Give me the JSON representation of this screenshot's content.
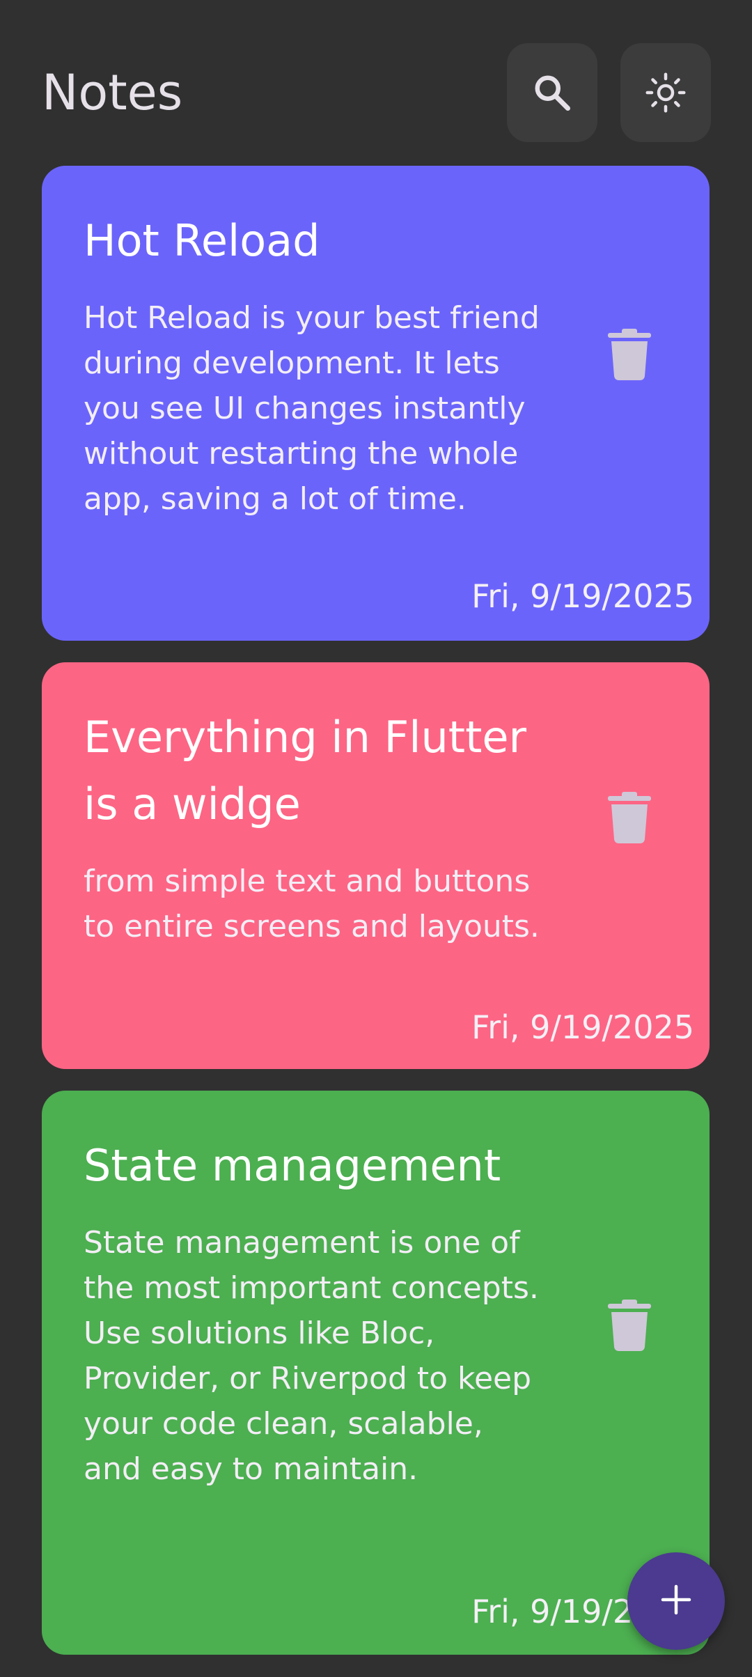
{
  "app": {
    "title": "Notes"
  },
  "header": {
    "search_icon": "search-icon",
    "theme_icon": "sun-icon"
  },
  "notes": [
    {
      "title": "Hot Reload",
      "body": "Hot Reload is your best friend during development. It lets you see UI changes instantly without restarting the whole app, saving a lot of time.",
      "date": "Fri, 9/19/2025",
      "color": "#6b64fb"
    },
    {
      "title": "Everything in Flutter is a widge",
      "body": "from simple text and buttons to entire screens and layouts.",
      "date": "Fri, 9/19/2025",
      "color": "#fd6585"
    },
    {
      "title": "State management",
      "body": "State management is one of the most important concepts. Use solutions like Bloc, Provider, or Riverpod to keep your code clean, scalable, and easy to maintain.",
      "date": "Fri, 9/19/2025",
      "color": "#4caf50"
    }
  ],
  "fab": {
    "icon": "plus-icon",
    "color": "#4b3a8f"
  },
  "colors": {
    "background": "#303030",
    "icon_button_bg": "#3c3c3c",
    "delete_icon": "#cfc8d8"
  }
}
